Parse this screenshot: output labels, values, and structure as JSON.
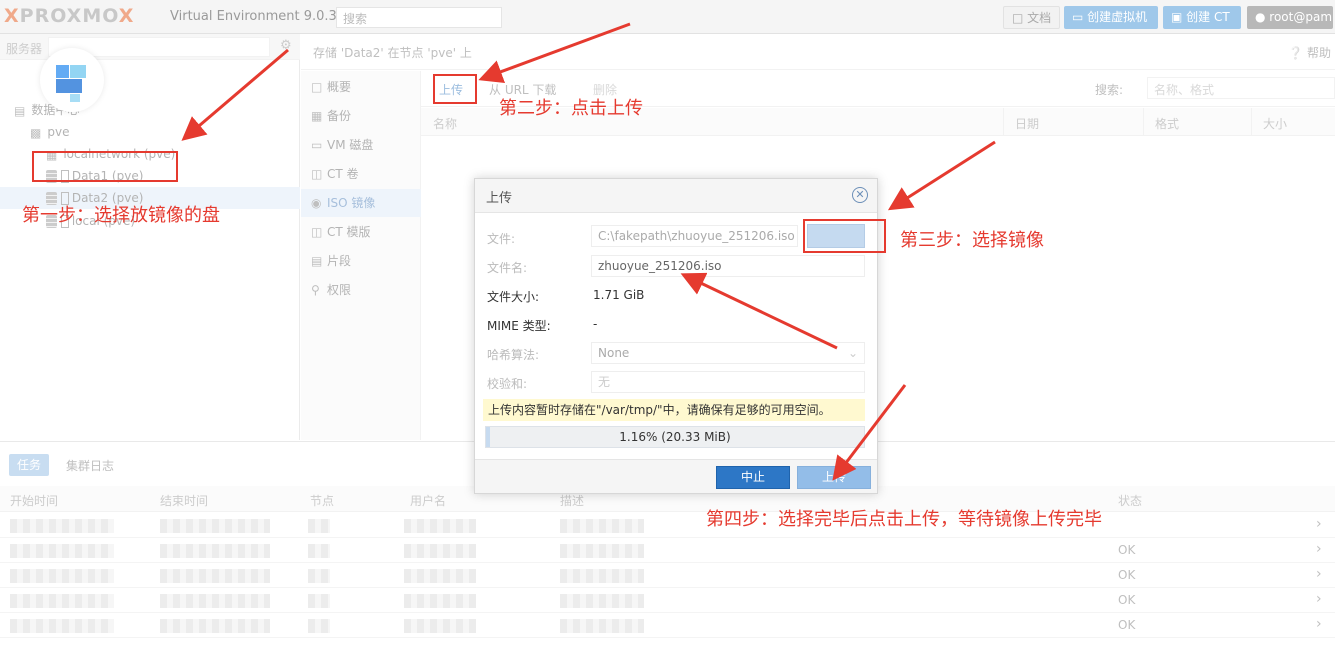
{
  "topbar": {
    "logo_prefix": "X",
    "logo_text": "PROXMO",
    "logo_suffix": "X",
    "version": "Virtual Environment 9.0.3",
    "search_placeholder": "搜索",
    "docs": "文档",
    "create_vm": "创建虚拟机",
    "create_ct": "创建 CT",
    "user": "root@pam"
  },
  "tree": {
    "view_label": "服务器",
    "datacenter": "数据中心",
    "node": "pve",
    "items": [
      "localnetwork (pve)",
      "Data1 (pve)",
      "Data2 (pve)",
      "local (pve)"
    ]
  },
  "content": {
    "title": "存储 'Data2' 在节点 'pve' 上",
    "help": "帮助"
  },
  "nav": [
    "概要",
    "备份",
    "VM 磁盘",
    "CT 卷",
    "ISO 镜像",
    "CT 模版",
    "片段",
    "权限"
  ],
  "toolbar": {
    "upload": "上传",
    "download_url": "从 URL 下载",
    "delete": "删除",
    "search_label": "搜索:",
    "search_placeholder": "名称、格式"
  },
  "grid_columns": [
    "名称",
    "日期",
    "格式",
    "大小"
  ],
  "tasks": {
    "tab_tasks": "任务",
    "tab_cluster_log": "集群日志",
    "columns": [
      "开始时间",
      "结束时间",
      "节点",
      "用户名",
      "描述",
      "状态"
    ],
    "rows": [
      {
        "status": ""
      },
      {
        "status": "OK"
      },
      {
        "status": "OK"
      },
      {
        "status": "OK"
      },
      {
        "status": "OK"
      }
    ]
  },
  "dialog": {
    "title": "上传",
    "file_label": "文件:",
    "file_value": "C:\\fakepath\\zhuoyue_251206.iso",
    "filename_label": "文件名:",
    "filename_value": "zhuoyue_251206.iso",
    "filesize_label": "文件大小:",
    "filesize_value": "1.71 GiB",
    "mime_label": "MIME 类型:",
    "mime_value": "-",
    "hash_label": "哈希算法:",
    "hash_value": "None",
    "checksum_label": "校验和:",
    "checksum_value": "无",
    "notice": "上传内容暂时存储在\"/var/tmp/\"中，请确保有足够的可用空间。",
    "progress_text": "1.16% (20.33 MiB)",
    "progress_value": 0.0116,
    "abort": "中止",
    "upload": "上传"
  },
  "annotations": {
    "step1": "第一步：选择放镜像的盘",
    "step2": "第二步：点击上传",
    "step3": "第三步：选择镜像",
    "step4": "第四步：选择完毕后点击上传，等待镜像上传完毕"
  },
  "colors": {
    "annotation": "#e53a2f",
    "primary_button": "#2d77c6",
    "selected_row": "#e8f1fa",
    "notice_bg": "#fff9d0"
  }
}
